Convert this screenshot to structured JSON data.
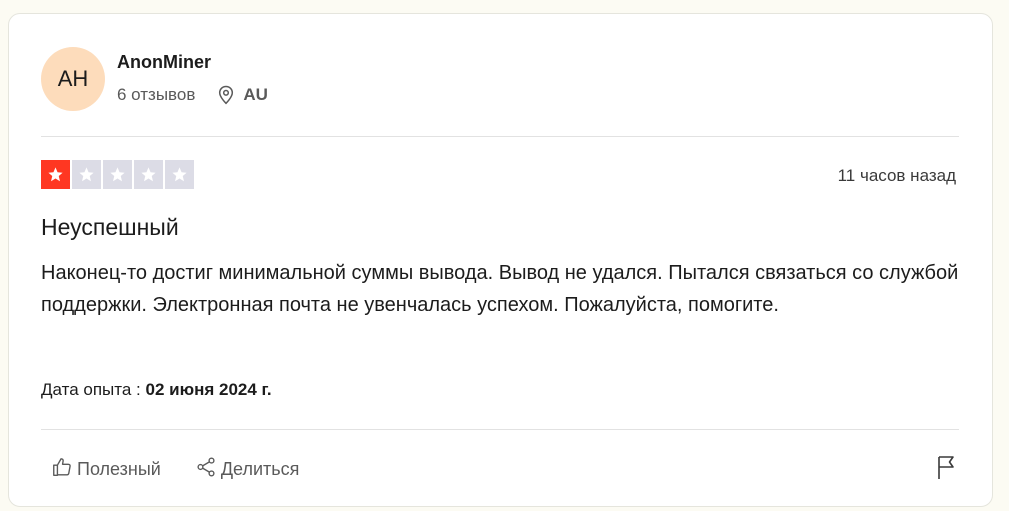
{
  "reviewer": {
    "initials": "AH",
    "name": "AnonMiner",
    "reviews_count": "6 отзывов",
    "country": "AU"
  },
  "review": {
    "rating": 1,
    "max_rating": 5,
    "time_ago": "11 часов назад",
    "title": "Неуспешный",
    "body": "Наконец-то достиг минимальной суммы вывода. Вывод не удался. Пытался связаться со службой поддержки. Электронная почта не увенчалась успехом. Пожалуйста, помогите.",
    "experience_label": "Дата опыта :",
    "experience_date": "02 июня 2024 г."
  },
  "actions": {
    "helpful_label": "Полезный",
    "share_label": "Делиться"
  },
  "colors": {
    "star_filled": "#ff3722",
    "star_empty": "#dcdce6",
    "avatar_bg": "#fddcbb"
  },
  "icons": [
    "location-pin-icon",
    "star-icon",
    "thumbs-up-icon",
    "share-icon",
    "flag-icon"
  ]
}
